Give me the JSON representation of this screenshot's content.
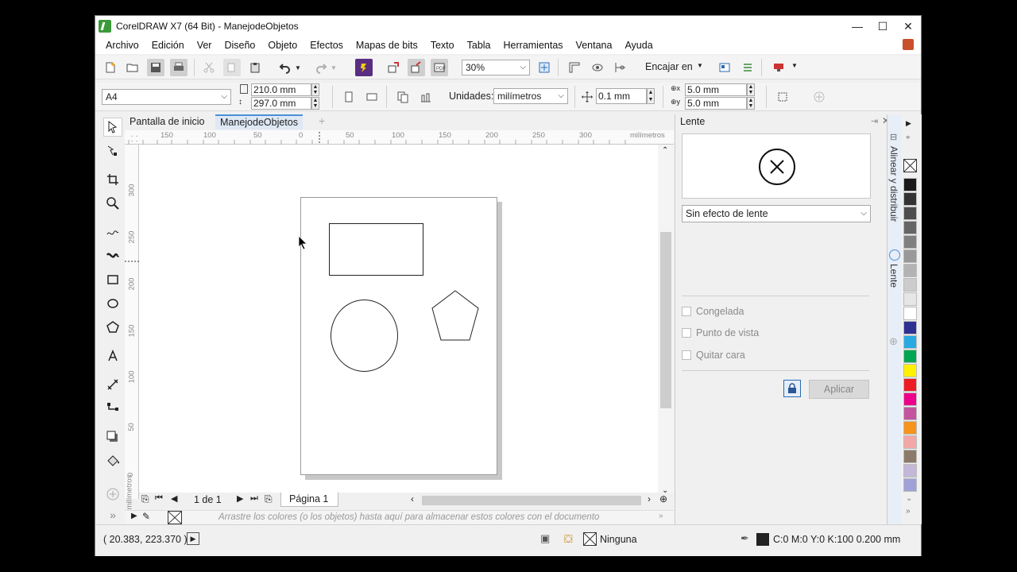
{
  "window": {
    "title": "CorelDRAW X7 (64 Bit) - ManejodeObjetos",
    "minimize": "—",
    "maximize": "☐",
    "close": "✕"
  },
  "menu": [
    "Archivo",
    "Edición",
    "Ver",
    "Diseño",
    "Objeto",
    "Efectos",
    "Mapas de bits",
    "Texto",
    "Tabla",
    "Herramientas",
    "Ventana",
    "Ayuda"
  ],
  "toolbar": {
    "zoom": "30%",
    "snap_label": "Encajar en"
  },
  "property_bar": {
    "page_size": "A4",
    "width": "210.0 mm",
    "height": "297.0 mm",
    "units_label": "Unidades:",
    "units_value": "milímetros",
    "nudge": "0.1 mm",
    "dup_x": "5.0 mm",
    "dup_y": "5.0 mm"
  },
  "doc_tabs": [
    "Pantalla de inicio",
    "ManejodeObjetos"
  ],
  "ruler": {
    "h_labels": [
      "150",
      "100",
      "50",
      "0",
      "50",
      "100",
      "150",
      "200",
      "250",
      "300"
    ],
    "h_unit": "milímetros",
    "v_labels": [
      "300",
      "250",
      "200",
      "150",
      "100",
      "50",
      "0"
    ],
    "v_unit": "milímetros"
  },
  "page_nav": {
    "count": "1 de 1",
    "page_tab": "Página 1"
  },
  "color_docker_hint": "Arrastre los colores (o los objetos) hasta aquí para almacenar estos colores con el documento",
  "docker": {
    "title": "Lente",
    "effect": "Sin efecto de lente",
    "checks": [
      "Congelada",
      "Punto de vista",
      "Quitar cara"
    ],
    "apply": "Aplicar",
    "side_tabs": [
      "Alinear y distribuir",
      "Lente"
    ]
  },
  "palette": [
    "#1a1a1a",
    "#333333",
    "#4d4d4d",
    "#666666",
    "#808080",
    "#999999",
    "#b3b3b3",
    "#cccccc",
    "#e6e6e6",
    "#ffffff",
    "#2e3192",
    "#29abe2",
    "#00a651",
    "#fff200",
    "#ed1c24",
    "#ec008c",
    "#c2559d",
    "#f7941d",
    "#f4a7a7",
    "#8c7b6b",
    "#c4b8d8",
    "#a0a0d8"
  ],
  "status": {
    "coords": "( 20.383, 223.370 )",
    "fill": "Ninguna",
    "outline": "C:0 M:0 Y:0 K:100  0.200 mm"
  }
}
